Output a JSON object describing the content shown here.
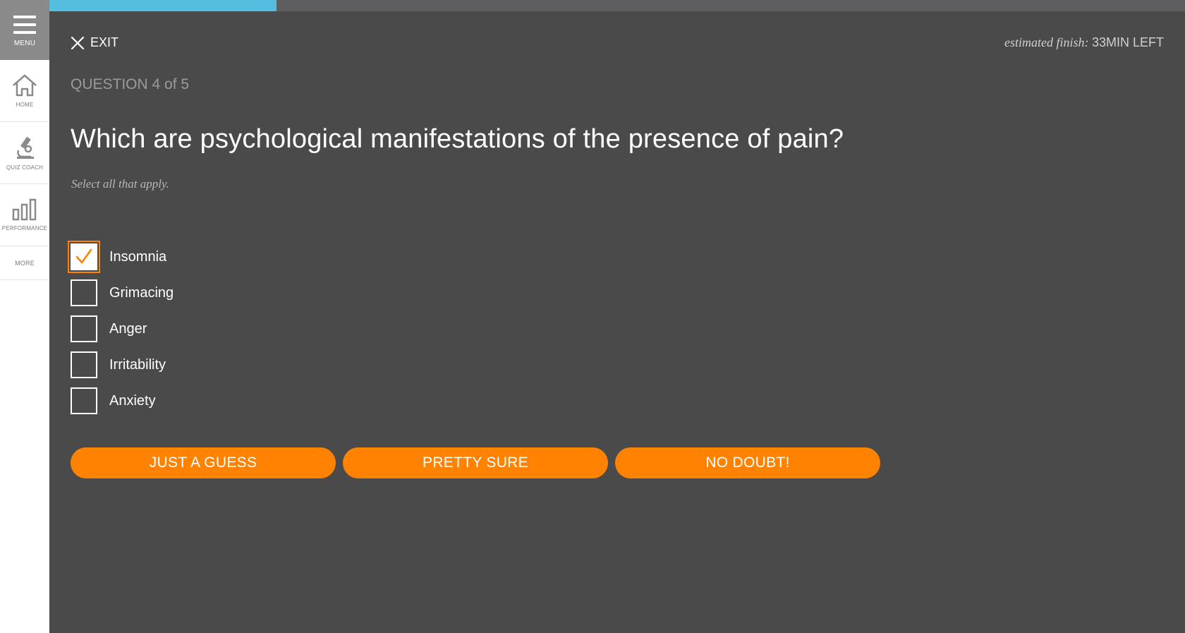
{
  "sidebar": {
    "menu_label": "MENU",
    "items": [
      {
        "label": "HOME",
        "icon": "home-icon"
      },
      {
        "label": "QUIZ COACH",
        "icon": "microscope-icon"
      },
      {
        "label": "PERFORMANCE",
        "icon": "bar-chart-icon"
      },
      {
        "label": "MORE"
      }
    ]
  },
  "progress": {
    "fraction": 0.2
  },
  "header": {
    "exit_label": "EXIT",
    "finish_prefix": "estimated finish:",
    "finish_value": "33MIN LEFT"
  },
  "question": {
    "number_label": "QUESTION 4 of 5",
    "text": "Which are psychological manifestations of the presence of pain?",
    "instruction": "Select all that apply."
  },
  "options": [
    {
      "label": "Insomnia",
      "checked": true
    },
    {
      "label": "Grimacing",
      "checked": false
    },
    {
      "label": "Anger",
      "checked": false
    },
    {
      "label": "Irritability",
      "checked": false
    },
    {
      "label": "Anxiety",
      "checked": false
    }
  ],
  "confidence_buttons": [
    "JUST A GUESS",
    "PRETTY SURE",
    "NO DOUBT!"
  ],
  "colors": {
    "background": "#4a4a4a",
    "accent": "#ff8200",
    "progress": "#55bde0",
    "sidebar_menu": "#8a8a8a"
  }
}
